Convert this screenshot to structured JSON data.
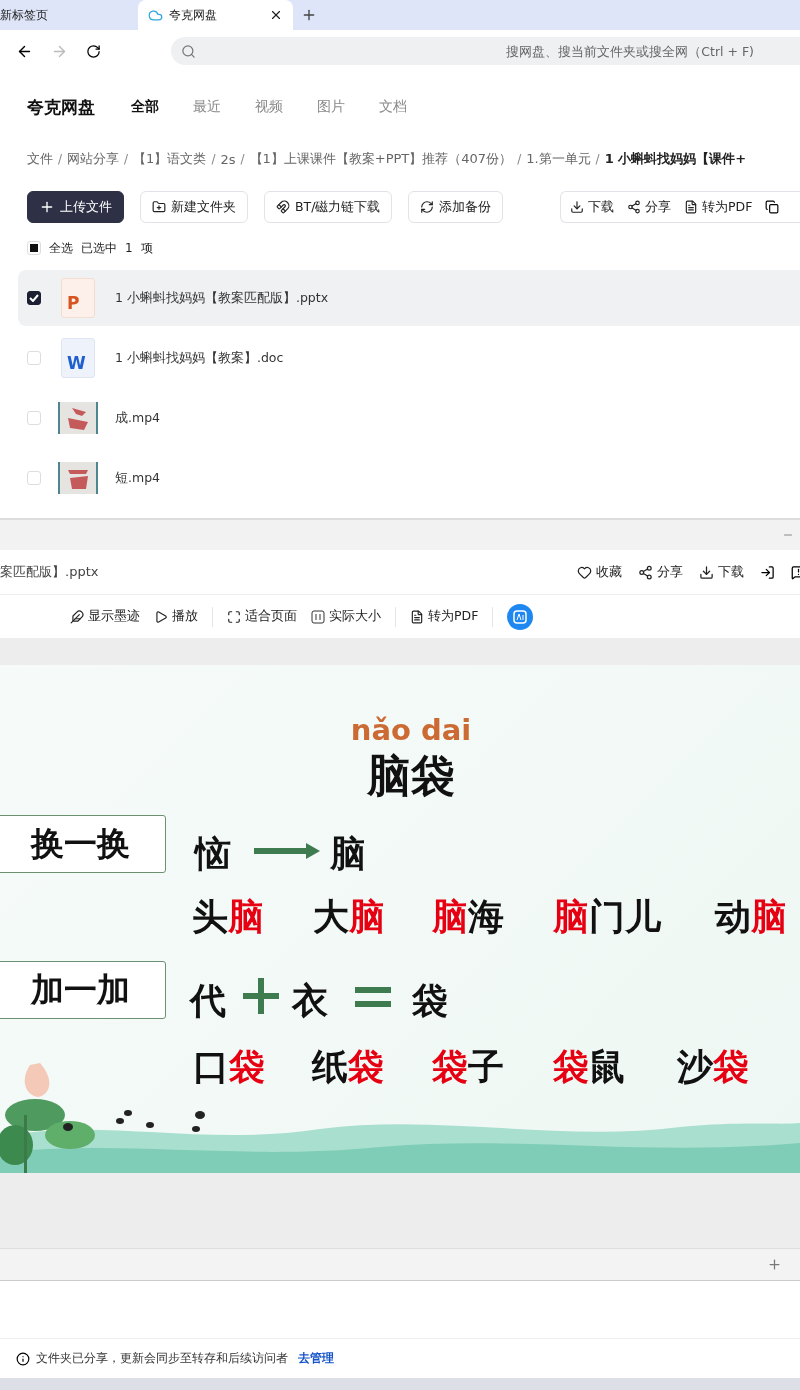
{
  "browser": {
    "tabs": [
      {
        "title": "新标签页",
        "selected": false
      },
      {
        "title": "夸克网盘",
        "selected": true
      }
    ],
    "search_placeholder": "搜网盘、搜当前文件夹或搜全网（Ctrl + F)"
  },
  "app": {
    "title": "夸克网盘",
    "nav": [
      {
        "label": "全部",
        "selected": true
      },
      {
        "label": "最近",
        "selected": false
      },
      {
        "label": "视频",
        "selected": false
      },
      {
        "label": "图片",
        "selected": false
      },
      {
        "label": "文档",
        "selected": false
      }
    ]
  },
  "breadcrumb": [
    {
      "label": "文件",
      "current": false
    },
    {
      "sep": "/",
      "label": "网站分享",
      "current": false
    },
    {
      "sep": "/",
      "label": "【1】语文类",
      "current": false
    },
    {
      "sep": "/",
      "label": "2s",
      "current": false
    },
    {
      "sep": "/",
      "label": "【1】上课课件【教案+PPT】推荐（407份）",
      "current": false
    },
    {
      "sep": "/",
      "label": "1.第一单元",
      "current": false
    },
    {
      "sep": "/",
      "label": "1 小蝌蚪找妈妈【课件+",
      "current": true
    }
  ],
  "actions": [
    {
      "label": "上传文件",
      "kind": "primary"
    },
    {
      "label": "新建文件夹",
      "kind": "plain"
    },
    {
      "label": "BT/磁力链下载",
      "kind": "plain"
    },
    {
      "label": "添加备份",
      "kind": "plain"
    }
  ],
  "file_actions": [
    "下载",
    "分享",
    "转为PDF"
  ],
  "selection": {
    "partial": true,
    "all_label": "全选",
    "selected_label": "已选中",
    "count": "1",
    "unit": "项"
  },
  "files": [
    {
      "name": "1 小蝌蚪找妈妈【教案匹配版】.pptx",
      "kind": "pptx",
      "icon_letter": "P",
      "selected": true
    },
    {
      "name": "1 小蝌蚪找妈妈【教案】.doc",
      "kind": "doc",
      "icon_letter": "W",
      "selected": false
    },
    {
      "name": "成.mp4",
      "kind": "video",
      "selected": false
    },
    {
      "name": "短.mp4",
      "kind": "video",
      "selected": false
    }
  ],
  "preview": {
    "title": "案匹配版】.pptx",
    "actions": [
      "收藏",
      "分享",
      "下载"
    ],
    "tools": [
      "显示墨迹",
      "播放",
      "适合页面",
      "实际大小",
      "转为PDF"
    ]
  },
  "slide": {
    "pinyin": "nǎo dai",
    "word": "脑袋",
    "labels": [
      "换一换",
      "加一加"
    ],
    "swap": {
      "from": "恼",
      "to": "脑"
    },
    "add": {
      "a": "代",
      "b": "衣",
      "result": "袋"
    },
    "row1": [
      [
        {
          "text": "头",
          "highlight": false
        },
        {
          "text": "脑",
          "highlight": true
        }
      ],
      [
        {
          "text": "大",
          "highlight": false
        },
        {
          "text": "脑",
          "highlight": true
        }
      ],
      [
        {
          "text": "脑",
          "highlight": true
        },
        {
          "text": "海",
          "highlight": false
        }
      ],
      [
        {
          "text": "脑",
          "highlight": true
        },
        {
          "text": "门儿",
          "highlight": false
        }
      ],
      [
        {
          "text": "动",
          "highlight": false
        },
        {
          "text": "脑",
          "highlight": true
        }
      ]
    ],
    "row2": [
      [
        {
          "text": "口",
          "highlight": false
        },
        {
          "text": "袋",
          "highlight": true
        }
      ],
      [
        {
          "text": "纸",
          "highlight": false
        },
        {
          "text": "袋",
          "highlight": true
        }
      ],
      [
        {
          "text": "袋",
          "highlight": true
        },
        {
          "text": "子",
          "highlight": false
        }
      ],
      [
        {
          "text": "袋",
          "highlight": true
        },
        {
          "text": "鼠",
          "highlight": false
        }
      ],
      [
        {
          "text": "沙",
          "highlight": false
        },
        {
          "text": "袋",
          "highlight": true
        }
      ]
    ]
  },
  "notice": {
    "text": "文件夹已分享，更新会同步至转存和后续访问者",
    "link": "去管理"
  }
}
